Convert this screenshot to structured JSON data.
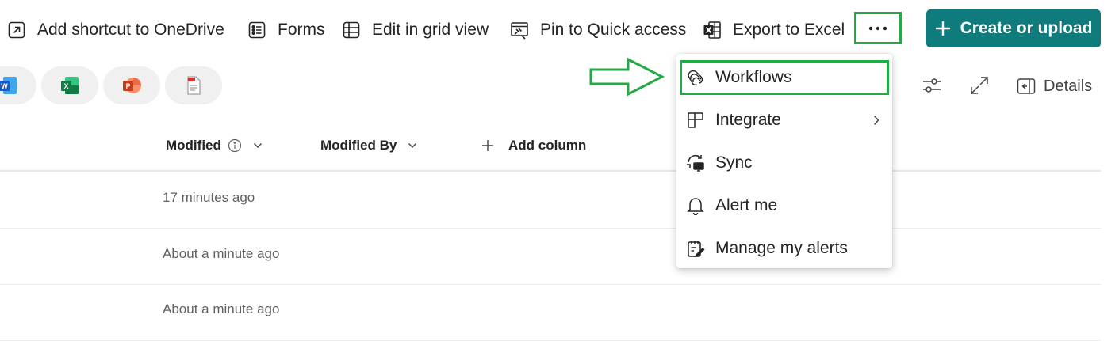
{
  "toolbar": {
    "add_shortcut": "Add shortcut to OneDrive",
    "forms": "Forms",
    "edit_grid": "Edit in grid view",
    "pin_quick": "Pin to Quick access",
    "export_excel": "Export to Excel",
    "create_upload": "Create or upload"
  },
  "file_types": [
    "word-icon",
    "excel-icon",
    "powerpoint-icon",
    "pdf-icon"
  ],
  "view": {
    "details": "Details"
  },
  "columns": {
    "modified": "Modified",
    "modified_by": "Modified By",
    "add_column": "Add column"
  },
  "rows": [
    {
      "modified": "17 minutes ago"
    },
    {
      "modified": "About a minute ago"
    },
    {
      "modified": "About a minute ago"
    }
  ],
  "menu": {
    "items": [
      {
        "label": "Workflows",
        "icon": "workflows-icon"
      },
      {
        "label": "Integrate",
        "icon": "integrate-icon"
      },
      {
        "label": "Sync",
        "icon": "sync-icon"
      },
      {
        "label": "Alert me",
        "icon": "bell-icon"
      },
      {
        "label": "Manage my alerts",
        "icon": "manage-alerts-icon"
      }
    ]
  },
  "colors": {
    "accent": "#0f7b7d",
    "highlight": "#22aa44",
    "text": "#242424",
    "muted": "#616161"
  }
}
